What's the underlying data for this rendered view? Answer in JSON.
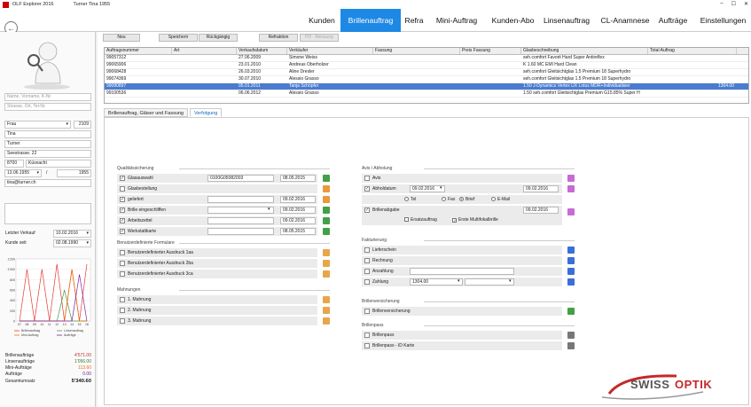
{
  "window": {
    "app_title": "OLF Explorer 2016",
    "user": "Turner Tina 1955"
  },
  "menu": [
    {
      "label": "Kunden",
      "active": false
    },
    {
      "label": "Brillenauftrag",
      "active": true
    },
    {
      "label": "Refra",
      "active": false
    },
    {
      "label": "Mini-Auftrag",
      "active": false
    },
    {
      "label": "Kunden-Abo",
      "active": false
    },
    {
      "label": "Linsenauftrag",
      "active": false
    },
    {
      "label": "CL-Anamnese",
      "active": false
    },
    {
      "label": "Aufträge",
      "active": false
    },
    {
      "label": "Einstellungen",
      "active": false
    }
  ],
  "customer": {
    "search_name_placeholder": "Name, Vorname, K-Nr.",
    "search_address_placeholder": "Strasse, Ort, Tel-Nr.",
    "salutation": "Frau",
    "number": "2109",
    "first_name": "Tina",
    "last_name": "Turner",
    "street": "Seestrasse. 22",
    "zip": "8700",
    "city": "Küsnacht",
    "birthdate": "13.06.1955",
    "slash": "/",
    "year": "1955",
    "email": "tina@turner.ch",
    "last_sale_label": "Letzter Verkauf",
    "last_sale": "10.02.2016",
    "customer_since_label": "Kunde seit",
    "customer_since": "02.08.1990"
  },
  "mini_chart": {
    "y_ticks": [
      "1'200",
      "1'000",
      "800",
      "600",
      "400",
      "200",
      "0"
    ],
    "x_ticks": [
      "07",
      "08",
      "09",
      "10",
      "11",
      "12",
      "13",
      "14",
      "15",
      "16"
    ],
    "legend": [
      "Brillenauftrag",
      "Linsenauftrag",
      "Mini-Auftrag",
      "Aufträge"
    ],
    "colors": {
      "Brillenauftrag": "#e53935",
      "Linsenauftrag": "#43a047",
      "Mini-Auftrag": "#ef6c00",
      "Aufträge": "#7b1fa2"
    }
  },
  "chart_data": {
    "type": "line",
    "x": [
      "07",
      "08",
      "09",
      "10",
      "11",
      "12",
      "13",
      "14",
      "15",
      "16"
    ],
    "ylim": [
      0,
      1200
    ],
    "series": [
      {
        "name": "Brillenauftrag",
        "values": [
          0,
          1000,
          0,
          1000,
          0,
          1100,
          0,
          1000,
          0,
          1100
        ]
      },
      {
        "name": "Linsenauftrag",
        "values": [
          0,
          0,
          0,
          0,
          0,
          0,
          600,
          0,
          0,
          0
        ]
      },
      {
        "name": "Mini-Auftrag",
        "values": [
          0,
          0,
          0,
          0,
          0,
          0,
          0,
          1000,
          0,
          0
        ]
      },
      {
        "name": "Aufträge",
        "values": [
          0,
          0,
          0,
          0,
          0,
          0,
          0,
          0,
          900,
          0
        ]
      }
    ]
  },
  "stats": [
    {
      "label": "Brillenaufträge",
      "value": "4'571.00",
      "color": "#c62828"
    },
    {
      "label": "Linsenaufträge",
      "value": "1'056.00",
      "color": "#2e7d32"
    },
    {
      "label": "Mini-Aufträge",
      "value": "113.60",
      "color": "#ef6c00"
    },
    {
      "label": "Aufträge",
      "value": "0.00",
      "color": "#6a1b9a"
    },
    {
      "label": "Gesamtumsatz",
      "value": "5'340.60",
      "color": "#111"
    }
  ],
  "toolbar": {
    "new": "Neu",
    "save": "Speichern",
    "undo": "Rückgängig",
    "refraktion": "Refraktion",
    "pd_measure": "PD - Messung"
  },
  "orders": {
    "columns": [
      "Auftragsnummer",
      "Art",
      "Verkaufsdatum",
      "Verkäufer",
      "Fassung",
      "Preis Fassung",
      "Glasbeschreibung",
      "Total Auftrag"
    ],
    "rows": [
      {
        "nr": "99057312",
        "art": "",
        "date": "27.06.2009",
        "seller": "Simone Weiss",
        "frame": "",
        "price": "",
        "glass": "seh.comfort Favorit   Hard Super  Antireflex",
        "total": "",
        "sel": false
      },
      {
        "nr": "99065906",
        "art": "",
        "date": "23.01.2010",
        "seller": "Andreas Oberholzer",
        "frame": "",
        "price": "",
        "glass": "K 1.60 MC EMI Hard Clean",
        "total": "",
        "sel": false
      },
      {
        "nr": "99068428",
        "art": "",
        "date": "26.03.2010",
        "seller": "Aline Drexler",
        "frame": "",
        "price": "",
        "glass": "seh.comfort Gleitsichtglas 1.5 Premium 18    Superhydro",
        "total": "",
        "sel": false
      },
      {
        "nr": "99074369",
        "art": "",
        "date": "30.07.2010",
        "seller": "Alessio Grasso",
        "frame": "",
        "price": "",
        "glass": "seh.comfort Gleitsichtglas 1.5 Premium 18    Superhydro",
        "total": "",
        "sel": false
      },
      {
        "nr": "99080897",
        "art": "",
        "date": "05.01.2011",
        "seller": "Tanja Schöpfer",
        "frame": "",
        "price": "",
        "glass": "1.50 J-Dynamics   Vertex UX Lotus  MDR+Individualisier",
        "total": "1304.00",
        "sel": true
      },
      {
        "nr": "99100536",
        "art": "",
        "date": "06.06.2012",
        "seller": "Alessio Grasso",
        "frame": "",
        "price": "",
        "glass": "1.50 seh.comfort Gleitsichtglas Premium  G15.85%  Super H",
        "total": "",
        "sel": false
      }
    ]
  },
  "tabs": [
    "Brillenauftrag, Gläser und Fassung",
    "Verfolgung"
  ],
  "qs": {
    "title": "Qualitätssicherung",
    "rows": [
      {
        "label": "Glasauswahl",
        "checked": true,
        "text": "0100G05082003",
        "date": "08.05.2015"
      },
      {
        "label": "Glasbestellung",
        "checked": false,
        "text": "",
        "date": ""
      },
      {
        "label": "geliefert",
        "checked": true,
        "text": "",
        "date": "09.02.2016"
      },
      {
        "label": "Brille eingeschliffen",
        "checked": true,
        "text": "",
        "date": "09.02.2016"
      },
      {
        "label": "Arbeitszettel",
        "checked": true,
        "text": "",
        "date": "09.02.2016"
      },
      {
        "label": "Werkstattkarte",
        "checked": true,
        "text": "",
        "date": "08.05.2015"
      }
    ]
  },
  "forms": {
    "title": "Benutzerdefinierte Formulare",
    "rows": [
      "Benutzerdefinierter Ausdruck 1aa",
      "Benutzerdefinierter Ausdruck 2ba",
      "Benutzerdefinierter Ausdruck 3ca"
    ]
  },
  "reminders": {
    "title": "Mahnungen",
    "rows": [
      "1. Mahnung",
      "2. Mahnung",
      "3. Mahnung"
    ]
  },
  "avis": {
    "title": "Avis / Abholung",
    "avis_label": "Avis",
    "pickup_label": "Abholdatum",
    "pickup_date": "09.02.2016",
    "pickup_date2": "09.02.2016",
    "radios": [
      {
        "label": "Tel",
        "on": false
      },
      {
        "label": "Fax",
        "on": false
      },
      {
        "label": "Brief",
        "on": true
      },
      {
        "label": "E-Mail",
        "on": false
      }
    ],
    "handover_label": "Brillenabgabe",
    "handover_date": "09.02.2016",
    "replacement_label": "Ersatzauftrag",
    "multifocal_label": "Erste Multifokalbrille"
  },
  "billing": {
    "title": "Fakturierung",
    "rows": [
      "Lieferschein",
      "Rechnung",
      "Anzahlung",
      "Zahlung"
    ],
    "payment": "1304.00"
  },
  "insurance": {
    "title": "Brillenversicherung",
    "row": "Brillenversicherung"
  },
  "pass": {
    "title": "Brillenpass",
    "rows": [
      "Brillenpass",
      "Brillenpass - ID Karte"
    ]
  },
  "brand": {
    "name": "SWISS",
    "name2": "OPTIK"
  }
}
